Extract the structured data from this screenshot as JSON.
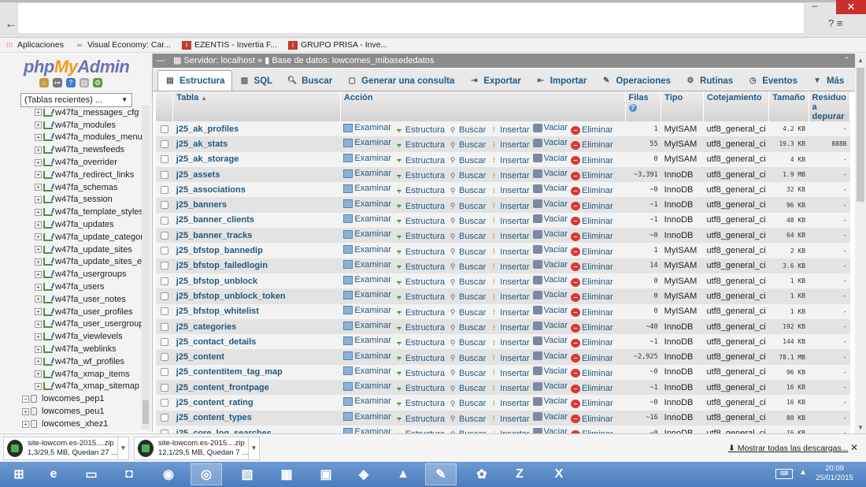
{
  "browser": {
    "window_min": "–",
    "window_close": "✕",
    "back": "←",
    "right_icons": "?  ≡"
  },
  "bookmarks": [
    {
      "label": "Aplicaciones",
      "icon": "apps-grid-icon"
    },
    {
      "label": "Visual Economy: Car...",
      "icon": "visual-economy-icon"
    },
    {
      "label": "EZENTIS - Invertia F...",
      "icon": "invertia-icon"
    },
    {
      "label": "GRUPO PRISA - Inve...",
      "icon": "invertia-icon"
    }
  ],
  "sidebar": {
    "logo_php": "php",
    "logo_my": "My",
    "logo_admin": "Admin",
    "recent_select": "(Tablas recientes) ...",
    "tables": [
      "w47fa_messages_cfg",
      "w47fa_modules",
      "w47fa_modules_menu",
      "w47fa_newsfeeds",
      "w47fa_overrider",
      "w47fa_redirect_links",
      "w47fa_schemas",
      "w47fa_session",
      "w47fa_template_styles",
      "w47fa_updates",
      "w47fa_update_categor",
      "w47fa_update_sites",
      "w47fa_update_sites_e",
      "w47fa_usergroups",
      "w47fa_users",
      "w47fa_user_notes",
      "w47fa_user_profiles",
      "w47fa_user_usergroup",
      "w47fa_viewlevels",
      "w47fa_weblinks",
      "w47fa_wf_profiles",
      "w47fa_xmap_items",
      "w47fa_xmap_sitemap"
    ],
    "databases": [
      "lowcomes_pep1",
      "lowcomes_peu1",
      "lowcomes_xhez1"
    ]
  },
  "breadcrumb": {
    "server": "Servidor: localhost",
    "sep": "»",
    "database": "Base de datos: lowcomes_mibasededatos"
  },
  "tabs": [
    {
      "label": "Estructura",
      "icon": "structure-icon",
      "active": true
    },
    {
      "label": "SQL",
      "icon": "sql-icon"
    },
    {
      "label": "Buscar",
      "icon": "search-icon"
    },
    {
      "label": "Generar una consulta",
      "icon": "query-icon"
    },
    {
      "label": "Exportar",
      "icon": "export-icon"
    },
    {
      "label": "Importar",
      "icon": "import-icon"
    },
    {
      "label": "Operaciones",
      "icon": "wrench-icon"
    },
    {
      "label": "Rutinas",
      "icon": "routines-icon"
    },
    {
      "label": "Eventos",
      "icon": "clock-icon"
    },
    {
      "label": "Más",
      "icon": "chevron-down-icon"
    }
  ],
  "table": {
    "headers": {
      "tabla": "Tabla",
      "accion": "Acción",
      "filas": "Filas",
      "tipo": "Tipo",
      "cotejamiento": "Cotejamiento",
      "tamano": "Tamaño",
      "residuo": "Residuo a depurar"
    },
    "actions": {
      "examinar": "Examinar",
      "estructura": "Estructura",
      "buscar": "Buscar",
      "insertar": "Insertar",
      "vaciar": "Vaciar",
      "eliminar": "Eliminar"
    },
    "rows": [
      {
        "name": "j25_ak_profiles",
        "rows": "1",
        "type": "MyISAM",
        "collation": "utf8_general_ci",
        "size": "4.2 KB",
        "overhead": "-"
      },
      {
        "name": "j25_ak_stats",
        "rows": "55",
        "type": "MyISAM",
        "collation": "utf8_general_ci",
        "size": "19.3 KB",
        "overhead": "888B"
      },
      {
        "name": "j25_ak_storage",
        "rows": "0",
        "type": "MyISAM",
        "collation": "utf8_general_ci",
        "size": "4 KB",
        "overhead": "-"
      },
      {
        "name": "j25_assets",
        "rows": "~3,391",
        "type": "InnoDB",
        "collation": "utf8_general_ci",
        "size": "1.9 MB",
        "overhead": "-"
      },
      {
        "name": "j25_associations",
        "rows": "~0",
        "type": "InnoDB",
        "collation": "utf8_general_ci",
        "size": "32 KB",
        "overhead": "-"
      },
      {
        "name": "j25_banners",
        "rows": "~1",
        "type": "InnoDB",
        "collation": "utf8_general_ci",
        "size": "96 KB",
        "overhead": "-"
      },
      {
        "name": "j25_banner_clients",
        "rows": "~1",
        "type": "InnoDB",
        "collation": "utf8_general_ci",
        "size": "48 KB",
        "overhead": "-"
      },
      {
        "name": "j25_banner_tracks",
        "rows": "~0",
        "type": "InnoDB",
        "collation": "utf8_general_ci",
        "size": "64 KB",
        "overhead": "-"
      },
      {
        "name": "j25_bfstop_bannedip",
        "rows": "1",
        "type": "MyISAM",
        "collation": "utf8_general_ci",
        "size": "2 KB",
        "overhead": "-"
      },
      {
        "name": "j25_bfstop_failedlogin",
        "rows": "14",
        "type": "MyISAM",
        "collation": "utf8_general_ci",
        "size": "3.6 KB",
        "overhead": "-"
      },
      {
        "name": "j25_bfstop_unblock",
        "rows": "0",
        "type": "MyISAM",
        "collation": "utf8_general_ci",
        "size": "1 KB",
        "overhead": "-"
      },
      {
        "name": "j25_bfstop_unblock_token",
        "rows": "0",
        "type": "MyISAM",
        "collation": "utf8_general_ci",
        "size": "1 KB",
        "overhead": "-"
      },
      {
        "name": "j25_bfstop_whitelist",
        "rows": "0",
        "type": "MyISAM",
        "collation": "utf8_general_ci",
        "size": "1 KB",
        "overhead": "-"
      },
      {
        "name": "j25_categories",
        "rows": "~40",
        "type": "InnoDB",
        "collation": "utf8_general_ci",
        "size": "192 KB",
        "overhead": "-"
      },
      {
        "name": "j25_contact_details",
        "rows": "~1",
        "type": "InnoDB",
        "collation": "utf8_general_ci",
        "size": "144 KB",
        "overhead": "-"
      },
      {
        "name": "j25_content",
        "rows": "~2,925",
        "type": "InnoDB",
        "collation": "utf8_general_ci",
        "size": "78.1 MB",
        "overhead": "-"
      },
      {
        "name": "j25_contentitem_tag_map",
        "rows": "~0",
        "type": "InnoDB",
        "collation": "utf8_general_ci",
        "size": "96 KB",
        "overhead": "-"
      },
      {
        "name": "j25_content_frontpage",
        "rows": "~1",
        "type": "InnoDB",
        "collation": "utf8_general_ci",
        "size": "16 KB",
        "overhead": "-"
      },
      {
        "name": "j25_content_rating",
        "rows": "~0",
        "type": "InnoDB",
        "collation": "utf8_general_ci",
        "size": "16 KB",
        "overhead": "-"
      },
      {
        "name": "j25_content_types",
        "rows": "~16",
        "type": "InnoDB",
        "collation": "utf8_general_ci",
        "size": "80 KB",
        "overhead": "-"
      },
      {
        "name": "j25_core_log_searches",
        "rows": "~0",
        "type": "InnoDB",
        "collation": "utf8_general_ci",
        "size": "16 KB",
        "overhead": "-"
      }
    ]
  },
  "downloads": {
    "items": [
      {
        "name": "site-lowcom.es-2015....zip",
        "status": "1,3/29,5 MB, Quedan 27 ..."
      },
      {
        "name": "site-lowcom.es-2015....zip",
        "status": "12,1/29,5 MB, Quedan 7 ..."
      }
    ],
    "show_all": "Mostrar todas las descargas...",
    "close": "✕"
  },
  "taskbar": {
    "time": "20:09",
    "date": "25/01/2015"
  },
  "colors": {
    "link": "#235a81",
    "logo_blue": "#6b72b7",
    "logo_orange": "#f39c12",
    "taskbar": "#4c7dbc",
    "eliminar_icon": "#d9392f"
  }
}
